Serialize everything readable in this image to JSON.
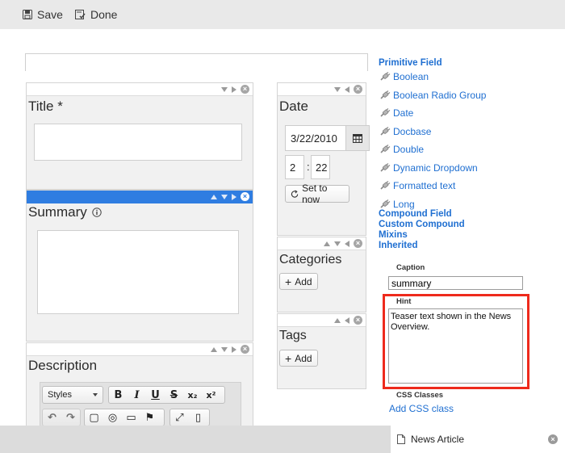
{
  "toolbar": {
    "save_label": "Save",
    "done_label": "Done"
  },
  "fields": {
    "title_label": "Title *",
    "summary_label": "Summary",
    "description_label": "Description",
    "date_label": "Date",
    "date_value": "3/22/2010",
    "hour_value": "2",
    "time_sep": ":",
    "minute_value": "22",
    "set_to_now_label": "Set to now",
    "categories_label": "Categories",
    "tags_label": "Tags",
    "add_label": "Add",
    "styles_label": "Styles"
  },
  "editor": {
    "bold": "B",
    "italic": "I",
    "underline": "U",
    "strike": "S",
    "subscript": "x₂",
    "superscript": "x²"
  },
  "palette": {
    "primitive_heading": "Primitive Field",
    "primitive_items": [
      "Boolean",
      "Boolean Radio Group",
      "Date",
      "Docbase",
      "Double",
      "Dynamic Dropdown",
      "Formatted text",
      "Long"
    ],
    "compound_heading": "Compound Field",
    "custom_compound_heading": "Custom Compound",
    "mixins_heading": "Mixins",
    "inherited_heading": "Inherited"
  },
  "properties": {
    "caption_label": "Caption",
    "caption_value": "summary",
    "hint_label": "Hint",
    "hint_value": "Teaser text shown in the News Overview.",
    "css_label": "CSS Classes",
    "add_css_label": "Add CSS class"
  },
  "tab": {
    "label": "News Article"
  },
  "colors": {
    "accent": "#2f7de1",
    "link": "#1f6fd1",
    "highlight": "#ee2a1c"
  },
  "icons": [
    "floppy-icon",
    "done-icon",
    "calendar-icon",
    "refresh-icon",
    "plus-icon",
    "info-icon",
    "plug-icon",
    "document-icon",
    "close-icon"
  ]
}
